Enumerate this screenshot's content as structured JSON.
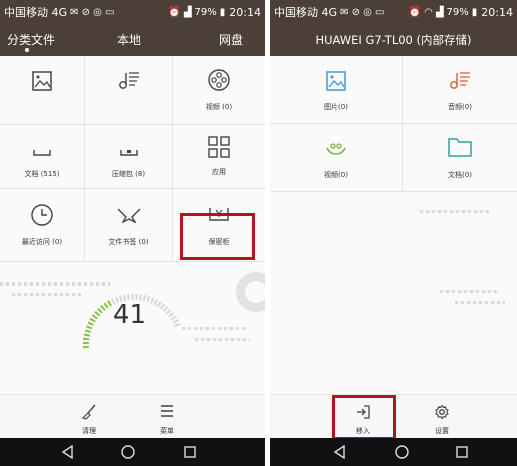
{
  "left": {
    "status": {
      "carrier": "中国移动 4G",
      "battery": "79%",
      "time": "20:14"
    },
    "tabs": [
      {
        "label": "分类文件",
        "active": true
      },
      {
        "label": "本地",
        "active": false
      },
      {
        "label": "网盘",
        "active": false
      }
    ],
    "grid": [
      {
        "label": "",
        "icon": "image-icon"
      },
      {
        "label": "",
        "icon": "music-icon"
      },
      {
        "label": "视频 (0)",
        "icon": "video-reel-icon"
      },
      {
        "label": "文档 (515)",
        "icon": "document-icon"
      },
      {
        "label": "压缩包 (8)",
        "icon": "archive-icon"
      },
      {
        "label": "应用",
        "icon": "apps-grid-icon"
      },
      {
        "label": "最近访问 (0)",
        "icon": "clock-icon"
      },
      {
        "label": "文件书签 (0)",
        "icon": "star-bookmark-icon"
      },
      {
        "label": "保密柜",
        "icon": "safe-icon"
      }
    ],
    "storage_number": "41",
    "bottom": [
      {
        "label": "清理",
        "icon": "broom-icon"
      },
      {
        "label": "菜单",
        "icon": "menu-icon"
      }
    ],
    "highlight_color": "#b0151d"
  },
  "right": {
    "status": {
      "carrier": "中国移动 4G",
      "battery": "79%",
      "time": "20:14"
    },
    "title": "HUAWEI G7-TL00 (内部存储)",
    "grid": [
      {
        "label": "图片(0)",
        "icon": "image-icon",
        "color": "#3a9ad9"
      },
      {
        "label": "音频(0)",
        "icon": "music-icon",
        "color": "#e05a2b"
      },
      {
        "label": "视频(0)",
        "icon": "video-icon",
        "color": "#7cb342"
      },
      {
        "label": "文档(0)",
        "icon": "folder-icon",
        "color": "#26a69a"
      }
    ],
    "bottom": [
      {
        "label": "移入",
        "icon": "move-in-icon"
      },
      {
        "label": "设置",
        "icon": "settings-gear-icon"
      }
    ]
  }
}
